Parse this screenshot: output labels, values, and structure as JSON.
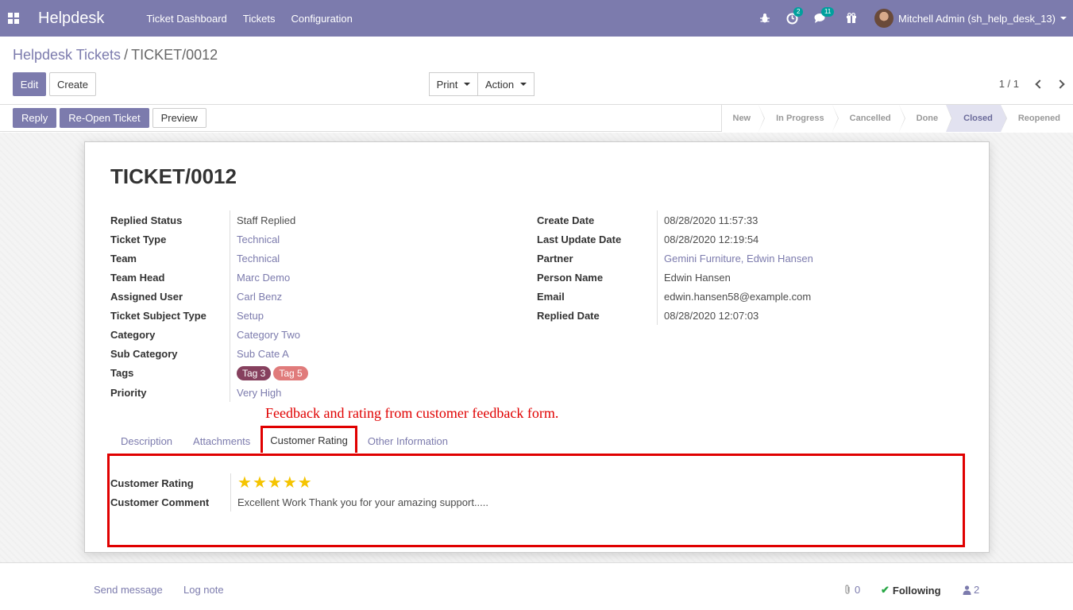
{
  "navbar": {
    "app_name": "Helpdesk",
    "menu": [
      "Ticket Dashboard",
      "Tickets",
      "Configuration"
    ],
    "activity_count": "2",
    "message_count": "11",
    "user_name": "Mitchell Admin (sh_help_desk_13)"
  },
  "breadcrumb": {
    "parent": "Helpdesk Tickets",
    "separator": "/",
    "current": "TICKET/0012"
  },
  "toolbar": {
    "edit_label": "Edit",
    "create_label": "Create",
    "print_label": "Print",
    "action_label": "Action",
    "pager": "1 / 1"
  },
  "statusbar": {
    "buttons": [
      "Reply",
      "Re-Open Ticket",
      "Preview"
    ],
    "stages": [
      "New",
      "In Progress",
      "Cancelled",
      "Done",
      "Closed",
      "Reopened"
    ],
    "active_stage": "Closed"
  },
  "form": {
    "title": "TICKET/0012",
    "left_fields": [
      {
        "label": "Replied Status",
        "value": "Staff Replied"
      },
      {
        "label": "Ticket Type",
        "value": "Technical"
      },
      {
        "label": "Team",
        "value": "Technical"
      },
      {
        "label": "Team Head",
        "value": "Marc Demo"
      },
      {
        "label": "Assigned User",
        "value": "Carl Benz"
      },
      {
        "label": "Ticket Subject Type",
        "value": "Setup"
      },
      {
        "label": "Category",
        "value": "Category Two"
      },
      {
        "label": "Sub Category",
        "value": "Sub Cate A"
      },
      {
        "label": "Tags",
        "value": ""
      },
      {
        "label": "Priority",
        "value": "Very High"
      }
    ],
    "tags": [
      "Tag 3",
      "Tag 5"
    ],
    "right_fields": [
      {
        "label": "Create Date",
        "value": "08/28/2020 11:57:33"
      },
      {
        "label": "Last Update Date",
        "value": "08/28/2020 12:19:54"
      },
      {
        "label": "Partner",
        "value": "Gemini Furniture, Edwin Hansen"
      },
      {
        "label": "Person Name",
        "value": "Edwin Hansen"
      },
      {
        "label": "Email",
        "value": "edwin.hansen58@example.com"
      },
      {
        "label": "Replied Date",
        "value": "08/28/2020 12:07:03"
      }
    ],
    "annotation": "Feedback and rating from customer feedback form.",
    "tabs": [
      "Description",
      "Attachments",
      "Customer Rating",
      "Other Information"
    ],
    "active_tab": "Customer Rating",
    "rating_label": "Customer Rating",
    "rating_value": 5,
    "rating_max": 5,
    "comment_label": "Customer Comment",
    "comment_value": "Excellent Work Thank you for your amazing support....."
  },
  "chatter": {
    "send_message": "Send message",
    "log_note": "Log note",
    "attachment_count": "0",
    "following": "Following",
    "follower_count": "2"
  },
  "colors": {
    "brand": "#7c7bad",
    "annotation": "#e00000",
    "star": "#f5c400",
    "tag_3": "#86405e",
    "tag_5": "#e07b7b"
  }
}
